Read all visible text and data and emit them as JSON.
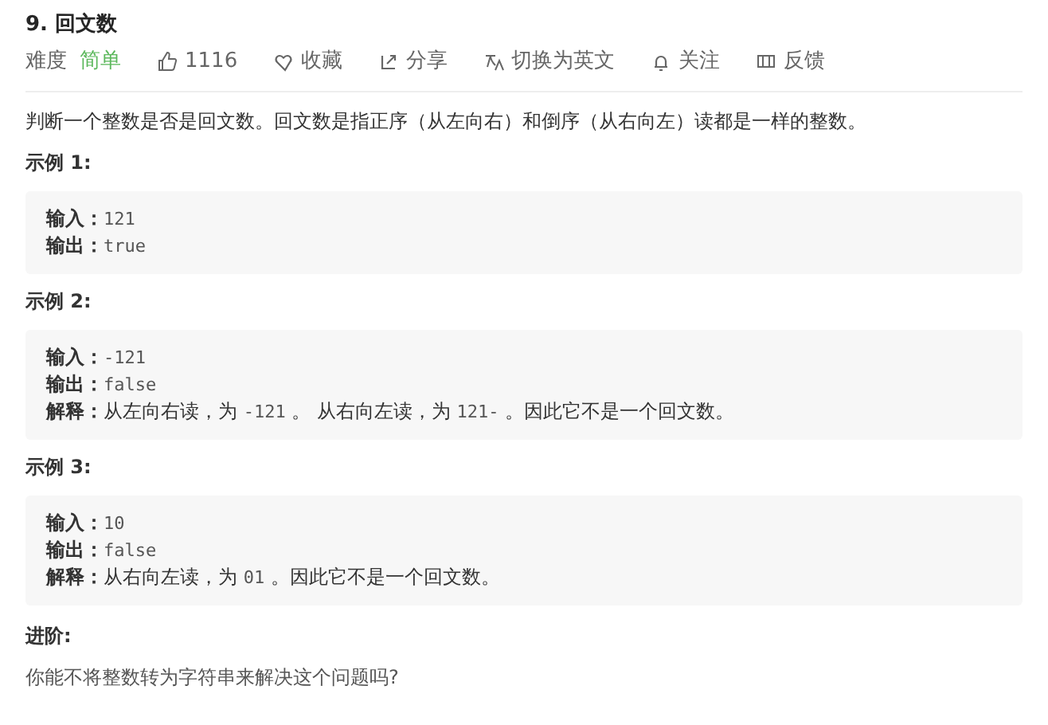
{
  "title": "9. 回文数",
  "toolbar": {
    "difficulty_label": "难度",
    "difficulty": "简单",
    "items": [
      {
        "kind": "like",
        "text": "1116"
      },
      {
        "kind": "heart",
        "text": "收藏"
      },
      {
        "kind": "share",
        "text": "分享"
      },
      {
        "kind": "translate",
        "text": "切换为英文"
      },
      {
        "kind": "bell",
        "text": "关注"
      },
      {
        "kind": "feedback",
        "text": "反馈"
      }
    ]
  },
  "description": "判断一个整数是否是回文数。回文数是指正序（从左向右）和倒序（从右向左）读都是一样的整数。",
  "examples": [
    {
      "heading": "示例 1:",
      "lines": [
        {
          "label": "输入：",
          "segments": [
            {
              "kind": "code",
              "text": "121"
            }
          ]
        },
        {
          "label": "输出：",
          "segments": [
            {
              "kind": "code",
              "text": "true"
            }
          ]
        }
      ]
    },
    {
      "heading": "示例 2:",
      "lines": [
        {
          "label": "输入：",
          "segments": [
            {
              "kind": "code",
              "text": "-121"
            }
          ]
        },
        {
          "label": "输出：",
          "segments": [
            {
              "kind": "code",
              "text": "false"
            }
          ]
        },
        {
          "label": "解释：",
          "segments": [
            {
              "kind": "text",
              "text": "从左向右读，为 "
            },
            {
              "kind": "code",
              "text": "-121"
            },
            {
              "kind": "text",
              "text": " 。 从右向左读，为 "
            },
            {
              "kind": "code",
              "text": "121-"
            },
            {
              "kind": "text",
              "text": " 。因此它不是一个回文数。"
            }
          ]
        }
      ]
    },
    {
      "heading": "示例 3:",
      "lines": [
        {
          "label": "输入：",
          "segments": [
            {
              "kind": "code",
              "text": "10"
            }
          ]
        },
        {
          "label": "输出：",
          "segments": [
            {
              "kind": "code",
              "text": "false"
            }
          ]
        },
        {
          "label": "解释：",
          "segments": [
            {
              "kind": "text",
              "text": "从右向左读，为 "
            },
            {
              "kind": "code",
              "text": "01"
            },
            {
              "kind": "text",
              "text": " 。因此它不是一个回文数。"
            }
          ]
        }
      ]
    }
  ],
  "advanced": {
    "heading": "进阶:",
    "text": "你能不将整数转为字符串来解决这个问题吗?"
  }
}
